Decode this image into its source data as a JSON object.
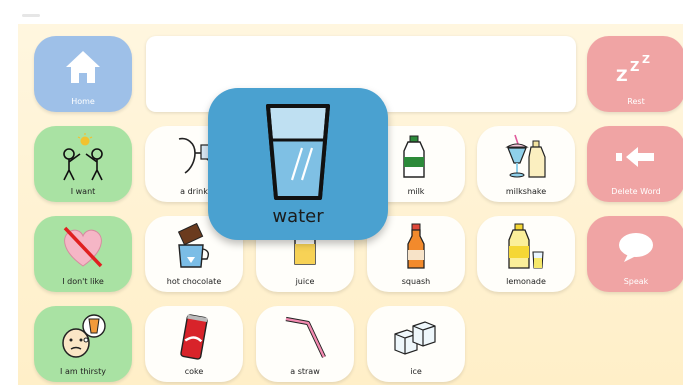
{
  "left_column": [
    {
      "label": "Home",
      "icon": "home-icon"
    },
    {
      "label": "I want",
      "icon": "person-want-icon"
    },
    {
      "label": "I don't like",
      "icon": "crossed-heart-icon"
    },
    {
      "label": "I am thirsty",
      "icon": "thirsty-face-icon"
    }
  ],
  "right_column": [
    {
      "label": "Rest",
      "icon": "zzz-icon"
    },
    {
      "label": "Delete Word",
      "icon": "delete-arrow-icon"
    },
    {
      "label": "Speak",
      "icon": "speech-bubble-icon"
    }
  ],
  "words": [
    {
      "label": "a drink",
      "icon": "drinking-person-icon"
    },
    {
      "label": "milk",
      "icon": "milk-bottle-icon"
    },
    {
      "label": "milkshake",
      "icon": "milkshake-icon"
    },
    {
      "label": "hot chocolate",
      "icon": "hot-chocolate-icon"
    },
    {
      "label": "juice",
      "icon": "juice-glass-icon"
    },
    {
      "label": "squash",
      "icon": "squash-bottle-icon"
    },
    {
      "label": "lemonade",
      "icon": "lemonade-icon"
    },
    {
      "label": "coke",
      "icon": "coke-can-icon"
    },
    {
      "label": "a straw",
      "icon": "straw-icon"
    },
    {
      "label": "ice",
      "icon": "ice-cubes-icon"
    }
  ],
  "popup": {
    "label": "water",
    "icon": "water-glass-icon"
  },
  "sentence_bar": {
    "text": ""
  },
  "colors": {
    "nav_blue": "#9ec0e8",
    "green": "#a9e2a3",
    "red": "#f0a4a4",
    "popup_blue": "#4aa1d0",
    "background": "#fff3d6"
  }
}
